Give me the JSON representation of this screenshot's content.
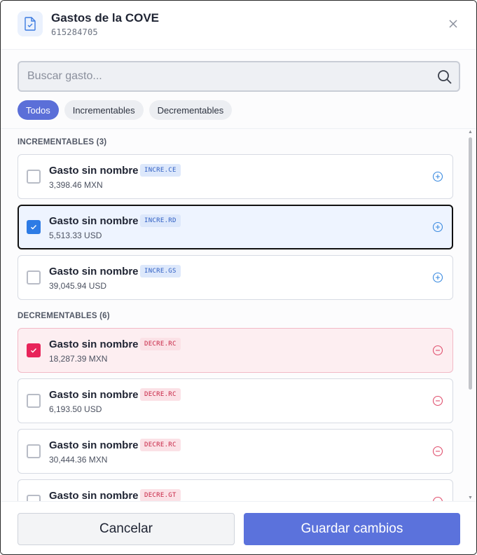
{
  "header": {
    "title": "Gastos de la COVE",
    "subtitle": "615284705",
    "icon": "document-check-icon"
  },
  "search": {
    "placeholder": "Buscar gasto...",
    "value": ""
  },
  "filters": [
    {
      "label": "Todos",
      "active": true
    },
    {
      "label": "Incrementables",
      "active": false
    },
    {
      "label": "Decrementables",
      "active": false
    }
  ],
  "incrementables": {
    "title": "INCREMENTABLES (3)",
    "items": [
      {
        "name": "Gasto sin nombre",
        "code": "INCRE.CE",
        "amount": "3,398.46 MXN",
        "checked": false
      },
      {
        "name": "Gasto sin nombre",
        "code": "INCRE.RD",
        "amount": "5,513.33 USD",
        "checked": true
      },
      {
        "name": "Gasto sin nombre",
        "code": "INCRE.GS",
        "amount": "39,045.94 USD",
        "checked": false
      }
    ]
  },
  "decrementables": {
    "title": "DECREMENTABLES (6)",
    "items": [
      {
        "name": "Gasto sin nombre",
        "code": "DECRE.RC",
        "amount": "18,287.39 MXN",
        "checked": true
      },
      {
        "name": "Gasto sin nombre",
        "code": "DECRE.RC",
        "amount": "6,193.50 USD",
        "checked": false
      },
      {
        "name": "Gasto sin nombre",
        "code": "DECRE.RC",
        "amount": "30,444.36 MXN",
        "checked": false
      },
      {
        "name": "Gasto sin nombre",
        "code": "DECRE.GT",
        "amount": "",
        "checked": false
      }
    ]
  },
  "footer": {
    "cancel_label": "Cancelar",
    "save_label": "Guardar cambios"
  },
  "colors": {
    "accent": "#5b72dc",
    "increment": "#2d7be5",
    "decrement": "#e8245a"
  }
}
